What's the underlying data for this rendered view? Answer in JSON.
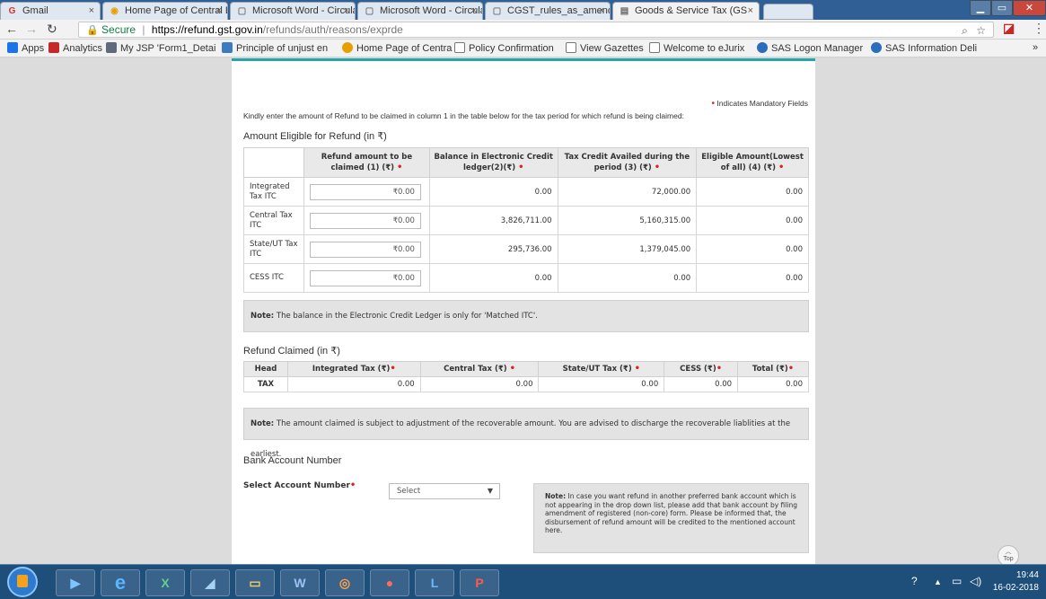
{
  "browser": {
    "tabs": [
      {
        "title": "Gmail",
        "icon": "G",
        "icon_color": "#d93025"
      },
      {
        "title": "Home Page of Central Bo",
        "icon": "◉",
        "icon_color": "#e7a000"
      },
      {
        "title": "Microsoft Word - Circula",
        "icon": "▢",
        "icon_color": "#777777"
      },
      {
        "title": "Microsoft Word - Circula",
        "icon": "▢",
        "icon_color": "#777777"
      },
      {
        "title": "CGST_rules_as_amended",
        "icon": "▢",
        "icon_color": "#777777"
      },
      {
        "title": "Goods & Service Tax (GS",
        "icon": "▤",
        "icon_color": "#666666"
      }
    ],
    "close_glyph": "×",
    "secure_label": "Secure",
    "url_host": "https://refund.gst.gov.in",
    "url_path": "/refunds/auth/reasons/exprde",
    "bookmarks": [
      {
        "label": "Apps",
        "icon": "apps-icon",
        "color": "#1a73e8"
      },
      {
        "label": "Analytics",
        "icon": "analytics-icon",
        "color": "#c62828"
      },
      {
        "label": "My JSP 'Form1_Detai",
        "icon": "page-icon",
        "color": "#5f6b7a"
      },
      {
        "label": "Principle of unjust en",
        "icon": "people-icon",
        "color": "#3b7bbf"
      },
      {
        "label": "Home Page of Centra",
        "icon": "globe-icon",
        "color": "#e7a000"
      },
      {
        "label": "Policy Confirmation",
        "icon": "page-icon",
        "color": "#777777"
      },
      {
        "label": "View Gazettes",
        "icon": "page-icon",
        "color": "#777777"
      },
      {
        "label": "Welcome to eJurix",
        "icon": "page-icon",
        "color": "#777777"
      },
      {
        "label": "SAS Logon Manager",
        "icon": "sas-icon",
        "color": "#2a6ebb"
      },
      {
        "label": "SAS Information Deli",
        "icon": "sas-icon",
        "color": "#2a6ebb"
      }
    ],
    "overflow_glyph": "»"
  },
  "page": {
    "mandatory_note": "Indicates Mandatory Fields",
    "instruction": "Kindly enter the amount of Refund to be claimed in column 1 in the table below for the tax period for which refund is being claimed:",
    "eligible": {
      "title": "Amount Eligible for Refund (in ₹)",
      "headers": [
        "Refund amount to be claimed (1) (₹)",
        "Balance in Electronic Credit ledger(2)(₹)",
        "Tax Credit Availed during the period (3) (₹)",
        "Eligible Amount(Lowest of all) (4) (₹)"
      ],
      "rows": [
        {
          "label": "Integrated Tax ITC",
          "claim": "₹0.00",
          "balance": "0.00",
          "availed": "72,000.00",
          "eligible": "0.00"
        },
        {
          "label": "Central Tax ITC",
          "claim": "₹0.00",
          "balance": "3,826,711.00",
          "availed": "5,160,315.00",
          "eligible": "0.00"
        },
        {
          "label": "State/UT Tax ITC",
          "claim": "₹0.00",
          "balance": "295,736.00",
          "availed": "1,379,045.00",
          "eligible": "0.00"
        },
        {
          "label": "CESS ITC",
          "claim": "₹0.00",
          "balance": "0.00",
          "availed": "0.00",
          "eligible": "0.00"
        }
      ],
      "note_label": "Note:",
      "note_text": "The balance in the Electronic Credit Ledger is only for 'Matched ITC'."
    },
    "claimed": {
      "title": "Refund Claimed (in ₹)",
      "headers": [
        "Head",
        "Integrated Tax (₹)",
        "Central Tax (₹)",
        "State/UT Tax (₹)",
        "CESS (₹)",
        "Total (₹)"
      ],
      "row": {
        "head": "TAX",
        "integrated": "0.00",
        "central": "0.00",
        "state": "0.00",
        "cess": "0.00",
        "total": "0.00"
      },
      "note_label": "Note:",
      "note_text": "The amount claimed is subject to adjustment of the recoverable amount. You are advised to discharge the recoverable liablities at the earliest."
    },
    "bank": {
      "title": "Bank Account Number",
      "select_label": "Select Account Number",
      "select_value": "Select",
      "note_label": "Note:",
      "note_text": "In case you want refund in another preferred bank account which is not appearing in the drop down list, please add that bank account by filing amendment of registered (non-core) form. Please be informed that, the disbursement of refund amount will be credited to the mentioned account here."
    },
    "mandatory_mark": "•",
    "top_button": "Top"
  },
  "taskbar": {
    "time": "19:44",
    "date": "16-02-2018",
    "apps": [
      {
        "name": "media-player",
        "glyph": "▶",
        "color": "#1b75bb"
      },
      {
        "name": "internet-explorer",
        "glyph": "e",
        "color": "#1f8fe0"
      },
      {
        "name": "excel",
        "glyph": "X",
        "color": "#1d7044"
      },
      {
        "name": "onenote",
        "glyph": "◢",
        "color": "#5a9bd6"
      },
      {
        "name": "file-explorer",
        "glyph": "▭",
        "color": "#e8c25c"
      },
      {
        "name": "word",
        "glyph": "W",
        "color": "#2b579a"
      },
      {
        "name": "firefox",
        "glyph": "◎",
        "color": "#e76e16"
      },
      {
        "name": "chrome",
        "glyph": "●",
        "color": "#db4437"
      },
      {
        "name": "lync",
        "glyph": "L",
        "color": "#1e79c7"
      },
      {
        "name": "pdf-reader",
        "glyph": "P",
        "color": "#d22a1e"
      }
    ]
  }
}
